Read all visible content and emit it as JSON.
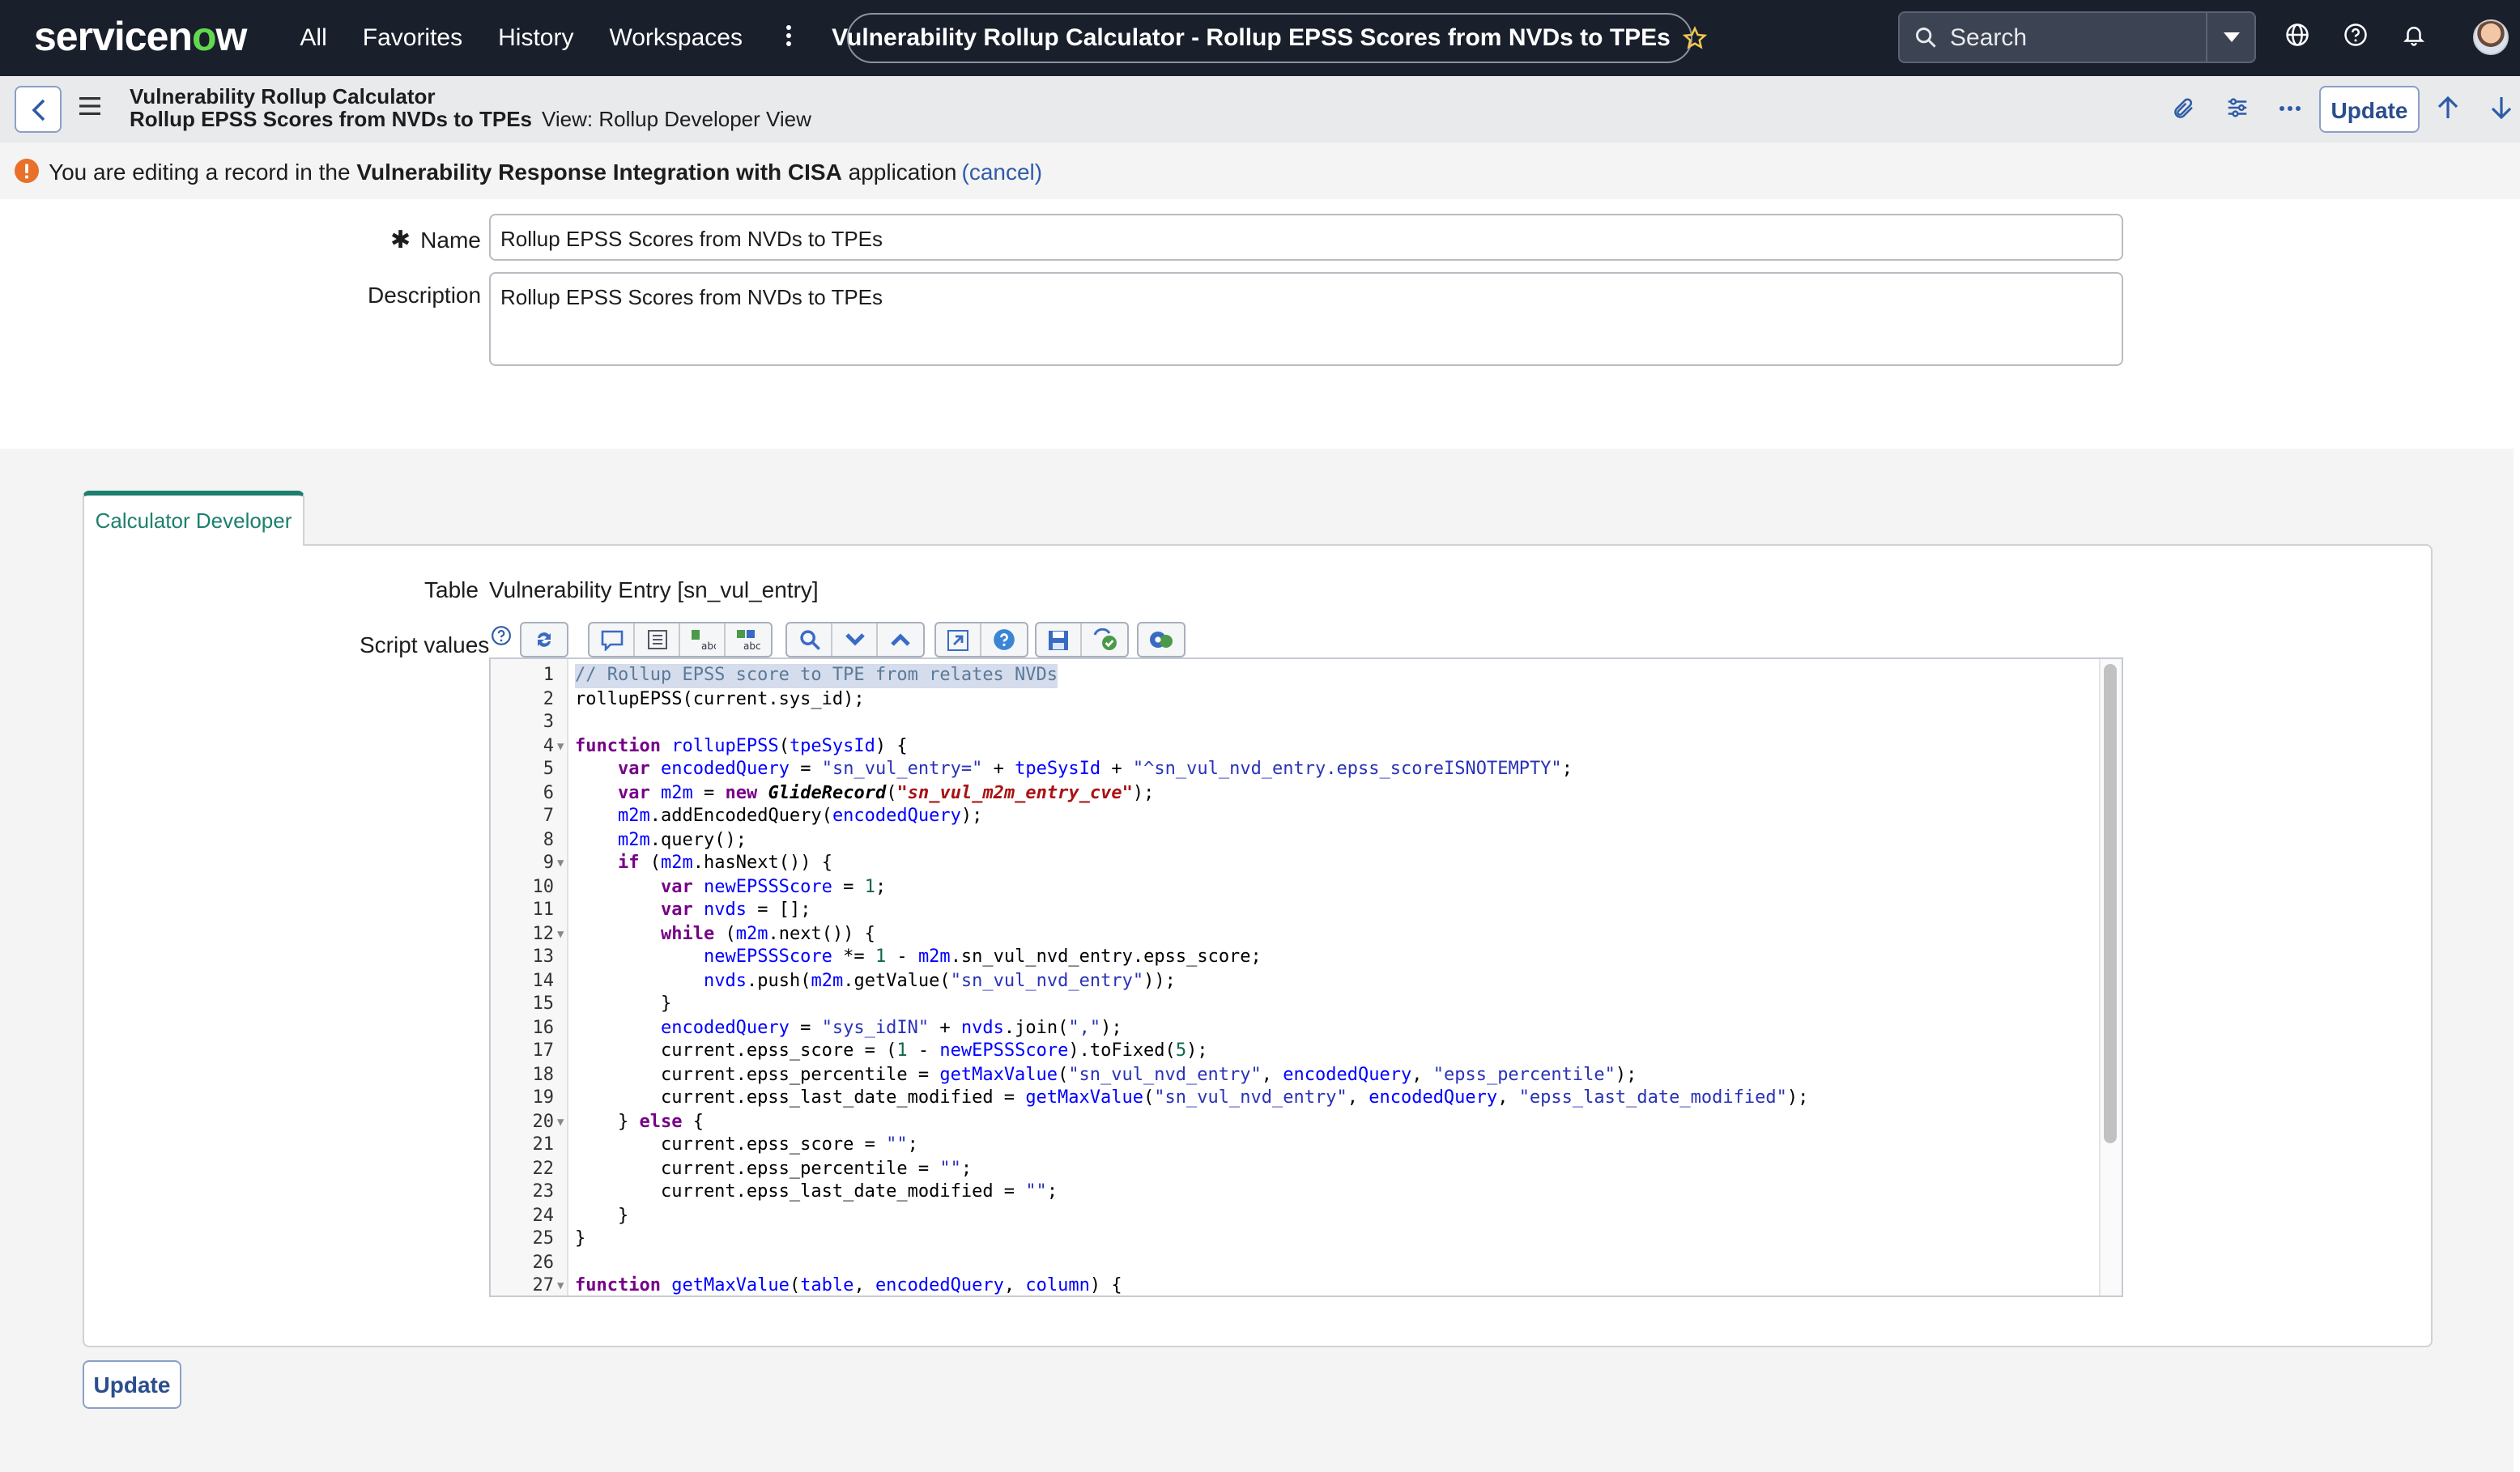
{
  "topnav": {
    "logo_service": "servicen",
    "logo_o": "o",
    "logo_w": "w",
    "menu": [
      "All",
      "Favorites",
      "History",
      "Workspaces"
    ],
    "more_icon": "more-vertical-icon",
    "record_title": "Vulnerability Rollup Calculator - Rollup EPSS Scores from NVDs to TPEs",
    "search_placeholder": "Search"
  },
  "record_header": {
    "title": "Vulnerability Rollup Calculator",
    "subtitle": "Rollup EPSS Scores from NVDs to TPEs",
    "view": "View: Rollup Developer View",
    "update_label": "Update"
  },
  "warning": {
    "prefix": "You are editing a record in the",
    "app_name": "Vulnerability Response Integration with CISA",
    "suffix": "application",
    "cancel": "(cancel)"
  },
  "form": {
    "name_label": "Name",
    "name_value": "Rollup EPSS Scores from NVDs to TPEs",
    "description_label": "Description",
    "description_value": "Rollup EPSS Scores from NVDs to TPEs"
  },
  "tab": {
    "label": "Calculator Developer",
    "table_label": "Table",
    "table_value": "Vulnerability Entry [sn_vul_entry]",
    "script_label": "Script values"
  },
  "toolbar_icons": [
    [
      "sync-icon"
    ],
    [
      "comment-icon",
      "format-icon",
      "replace-icon",
      "replace-all-icon"
    ],
    [
      "search-icon",
      "chevron-down-icon",
      "chevron-up-icon"
    ],
    [
      "fullscreen-icon",
      "help-icon"
    ],
    [
      "save-icon",
      "script-check-icon"
    ],
    [
      "debug-icon"
    ]
  ],
  "code": {
    "lines": [
      "// Rollup EPSS score to TPE from relates NVDs",
      "rollupEPSS(current.sys_id);",
      "",
      "function rollupEPSS(tpeSysId) {",
      "    var encodedQuery = \"sn_vul_entry=\" + tpeSysId + \"^sn_vul_nvd_entry.epss_scoreISNOTEMPTY\";",
      "    var m2m = new GlideRecord(\"sn_vul_m2m_entry_cve\");",
      "    m2m.addEncodedQuery(encodedQuery);",
      "    m2m.query();",
      "    if (m2m.hasNext()) {",
      "        var newEPSSScore = 1;",
      "        var nvds = [];",
      "        while (m2m.next()) {",
      "            newEPSSScore *= 1 - m2m.sn_vul_nvd_entry.epss_score;",
      "            nvds.push(m2m.getValue(\"sn_vul_nvd_entry\"));",
      "        }",
      "        encodedQuery = \"sys_idIN\" + nvds.join(\",\");",
      "        current.epss_score = (1 - newEPSSScore).toFixed(5);",
      "        current.epss_percentile = getMaxValue(\"sn_vul_nvd_entry\", encodedQuery, \"epss_percentile\");",
      "        current.epss_last_date_modified = getMaxValue(\"sn_vul_nvd_entry\", encodedQuery, \"epss_last_date_modified\");",
      "    } else {",
      "        current.epss_score = \"\";",
      "        current.epss_percentile = \"\";",
      "        current.epss_last_date_modified = \"\";",
      "    }",
      "}",
      "",
      "function getMaxValue(table, encodedQuery, column) {"
    ],
    "fold_lines": [
      4,
      9,
      12,
      20,
      27
    ]
  },
  "bottom": {
    "update_label": "Update"
  },
  "colors": {
    "nav_bg": "#1a1f2c",
    "tab_accent": "#1d7f6e",
    "link": "#2e5ba8",
    "warning": "#e8702a"
  }
}
